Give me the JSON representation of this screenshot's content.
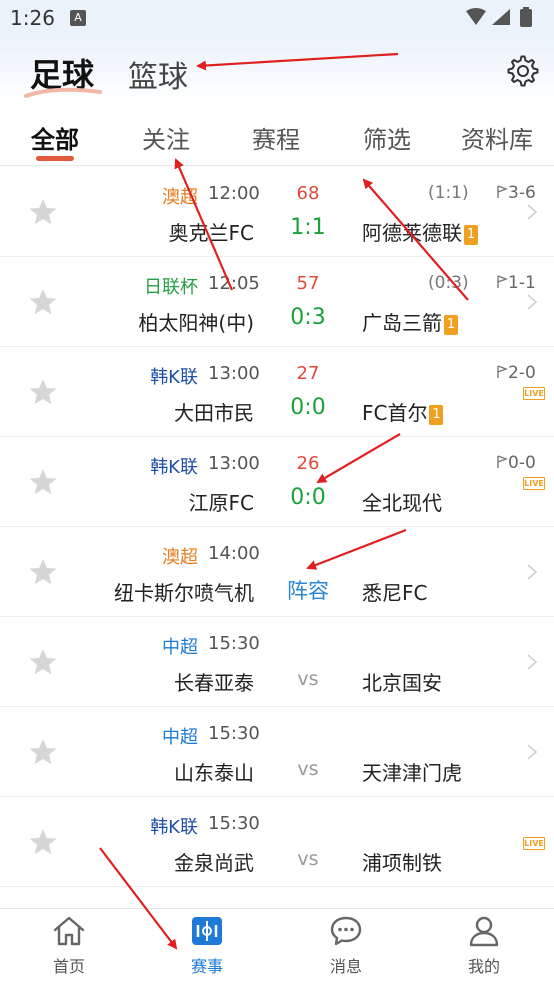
{
  "status_bar": {
    "time": "1:26",
    "notification_badge": "A"
  },
  "header": {
    "active_sport": "足球",
    "other_sport": "篮球",
    "settings_icon": "gear-icon"
  },
  "tabs": [
    {
      "label": "全部",
      "active": true
    },
    {
      "label": "关注",
      "active": false
    },
    {
      "label": "赛程",
      "active": false
    },
    {
      "label": "筛选",
      "active": false
    },
    {
      "label": "资料库",
      "active": false
    }
  ],
  "matches": [
    {
      "league": "澳超",
      "league_color": "#e67e22",
      "time": "12:00",
      "home": "奥克兰FC",
      "minute": "68",
      "score": "1:1",
      "away": "阿德莱德联",
      "away_card": "1",
      "halftime": "(1:1)",
      "corners": "3-6",
      "live": false
    },
    {
      "league": "日联杯",
      "league_color": "#27a046",
      "time": "12:05",
      "home": "柏太阳神(中)",
      "minute": "57",
      "score": "0:3",
      "away": "广岛三箭",
      "away_card": "1",
      "halftime": "(0:3)",
      "corners": "1-1",
      "live": false
    },
    {
      "league": "韩K联",
      "league_color": "#1f4fa8",
      "time": "13:00",
      "home": "大田市民",
      "minute": "27",
      "score": "0:0",
      "away": "FC首尔",
      "away_card": "1",
      "halftime": "",
      "corners": "2-0",
      "live": true
    },
    {
      "league": "韩K联",
      "league_color": "#1f4fa8",
      "time": "13:00",
      "home": "江原FC",
      "minute": "26",
      "score": "0:0",
      "away": "全北现代",
      "away_card": "",
      "halftime": "",
      "corners": "0-0",
      "live": true
    },
    {
      "league": "澳超",
      "league_color": "#e67e22",
      "time": "14:00",
      "home": "纽卡斯尔喷气机",
      "minute": "",
      "score": "阵容",
      "away": "悉尼FC",
      "away_card": "",
      "halftime": "",
      "corners": "",
      "live": false
    },
    {
      "league": "中超",
      "league_color": "#1e7ad6",
      "time": "15:30",
      "home": "长春亚泰",
      "minute": "",
      "score": "vs",
      "away": "北京国安",
      "away_card": "",
      "halftime": "",
      "corners": "",
      "live": false
    },
    {
      "league": "中超",
      "league_color": "#1e7ad6",
      "time": "15:30",
      "home": "山东泰山",
      "minute": "",
      "score": "vs",
      "away": "天津津门虎",
      "away_card": "",
      "halftime": "",
      "corners": "",
      "live": false
    },
    {
      "league": "韩K联",
      "league_color": "#1f4fa8",
      "time": "15:30",
      "home": "金泉尚武",
      "minute": "",
      "score": "vs",
      "away": "浦项制铁",
      "away_card": "",
      "halftime": "",
      "corners": "",
      "live": true
    }
  ],
  "live_badge": "LIVE",
  "bottom_nav": [
    {
      "label": "首页",
      "icon": "home-icon",
      "active": false
    },
    {
      "label": "赛事",
      "icon": "match-icon",
      "active": true
    },
    {
      "label": "消息",
      "icon": "chat-icon",
      "active": false
    },
    {
      "label": "我的",
      "icon": "user-icon",
      "active": false
    }
  ],
  "colors": {
    "accent": "#1e7ad6",
    "score_green": "#19a23a",
    "minute_red": "#e04a3a",
    "tab_underline": "#e25a3b",
    "annotation_arrow": "#e02020"
  }
}
